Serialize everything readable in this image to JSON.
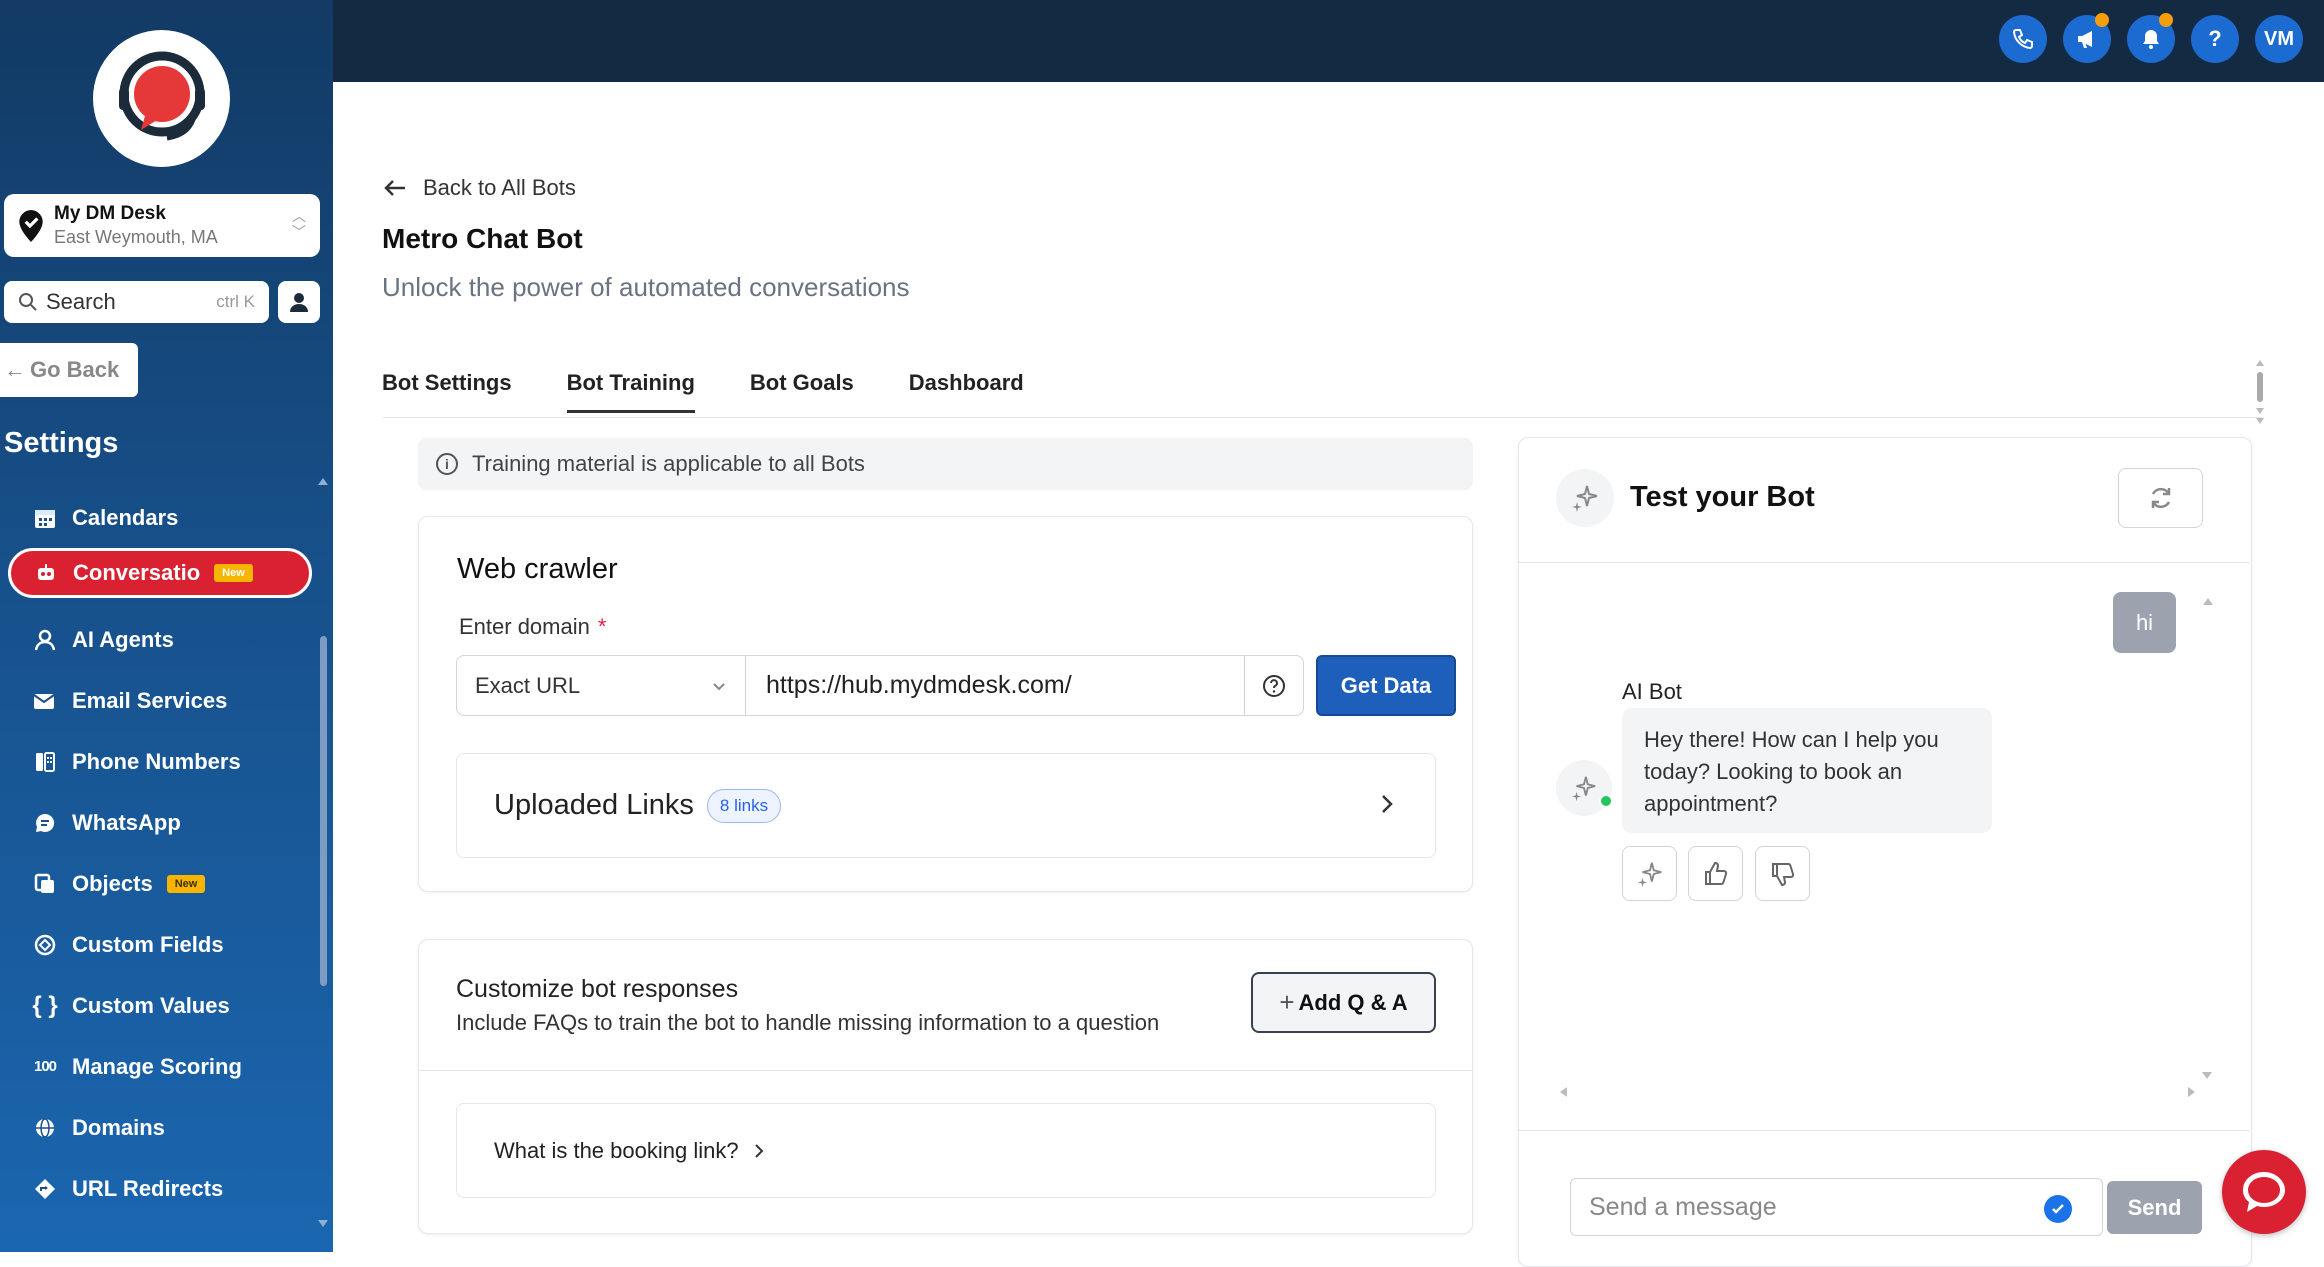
{
  "sidebar": {
    "location": {
      "name": "My DM Desk",
      "address": "East Weymouth, MA"
    },
    "search": {
      "label": "Search",
      "shortcut": "ctrl K"
    },
    "go_back": "Go Back",
    "heading": "Settings",
    "items": [
      {
        "label": "Calendars",
        "icon": "calendar-icon"
      },
      {
        "label": "Conversatio",
        "icon": "bot-icon",
        "badge": "New",
        "active": true
      },
      {
        "label": "AI Agents",
        "icon": "ai-agent-icon"
      },
      {
        "label": "Email Services",
        "icon": "email-icon"
      },
      {
        "label": "Phone Numbers",
        "icon": "phone-numbers-icon"
      },
      {
        "label": "WhatsApp",
        "icon": "whatsapp-icon"
      },
      {
        "label": "Objects",
        "icon": "objects-icon",
        "badge": "New"
      },
      {
        "label": "Custom Fields",
        "icon": "custom-fields-icon"
      },
      {
        "label": "Custom Values",
        "icon": "braces-icon"
      },
      {
        "label": "Manage Scoring",
        "icon": "scoring-icon"
      },
      {
        "label": "Domains",
        "icon": "globe-icon"
      },
      {
        "label": "URL Redirects",
        "icon": "redirect-icon"
      }
    ]
  },
  "topbar": {
    "avatar_initials": "VM",
    "help": "?"
  },
  "page": {
    "back": "Back to All Bots",
    "title": "Metro Chat Bot",
    "subtitle": "Unlock the power of automated conversations",
    "tabs": [
      {
        "label": "Bot Settings"
      },
      {
        "label": "Bot Training",
        "active": true
      },
      {
        "label": "Bot Goals"
      },
      {
        "label": "Dashboard"
      }
    ]
  },
  "training": {
    "info": "Training material is applicable to all Bots",
    "web_crawler": {
      "title": "Web crawler",
      "domain_label": "Enter domain",
      "required_mark": "*",
      "match_type": "Exact URL",
      "url": "https://hub.mydmdesk.com/",
      "get_data": "Get Data",
      "uploaded_label": "Uploaded Links",
      "links_count": "8 links"
    },
    "custom_responses": {
      "title": "Customize bot responses",
      "subtitle": "Include FAQs to train the bot to handle missing information to a question",
      "add_button": "Add Q & A",
      "faqs": [
        "What is the booking link?"
      ]
    }
  },
  "test_bot": {
    "title": "Test your Bot",
    "user_message": "hi",
    "bot_name": "AI Bot",
    "bot_message": "Hey there! How can I help you today? Looking to book an appointment?",
    "input_placeholder": "Send a message",
    "send": "Send"
  },
  "colors": {
    "accent": "#1d5fba",
    "active_nav": "#d92132",
    "badge": "#f7b500",
    "topbar": "#142a42"
  }
}
